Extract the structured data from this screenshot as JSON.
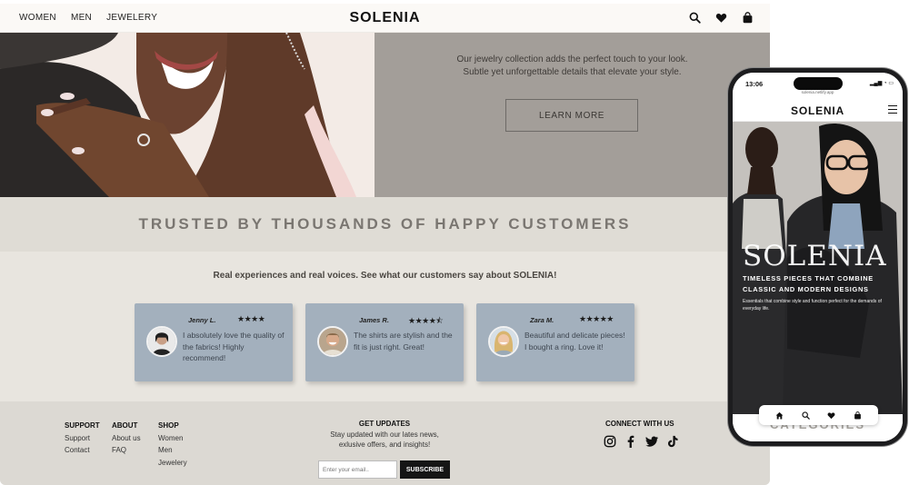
{
  "desktop": {
    "nav": {
      "links": [
        "WOMEN",
        "MEN",
        "JEWELERY"
      ],
      "brand": "SOLENIA",
      "icons": [
        "search-icon",
        "heart-icon",
        "bag-icon"
      ]
    },
    "hero": {
      "text_line1": "Our jewelry collection adds the perfect touch to your look.",
      "text_line2": "Subtle yet unforgettable details that elevate your style.",
      "cta": "LEARN MORE"
    },
    "trusted_heading": "TRUSTED BY THOUSANDS OF HAPPY CUSTOMERS",
    "reviews_subtitle": "Real experiences and real voices. See what our customers say about SOLENIA!",
    "reviews": [
      {
        "name": "Jenny L.",
        "stars": "★★★★",
        "text": "I absolutely love the quality of the fabrics! Highly recommend!"
      },
      {
        "name": "James R.",
        "stars": "★★★★⯪",
        "text": "The shirts are stylish and the fit is just right. Great!"
      },
      {
        "name": "Zara M.",
        "stars": "★★★★★",
        "text": "Beautiful and delicate pieces! I bought a ring. Love it!"
      }
    ],
    "footer": {
      "support": {
        "heading": "SUPPORT",
        "items": [
          "Support",
          "Contact"
        ]
      },
      "about": {
        "heading": "ABOUT",
        "items": [
          "About us",
          "FAQ"
        ]
      },
      "shop": {
        "heading": "SHOP",
        "items": [
          "Women",
          "Men",
          "Jewelery"
        ]
      },
      "updates": {
        "heading": "GET UPDATES",
        "line1": "Stay updated with our lates news,",
        "line2": "exlusive offers, and insights!",
        "placeholder": "Enter your email..",
        "button": "SUBSCRIBE"
      },
      "connect": {
        "heading": "CONNECT WITH US",
        "icons": [
          "instagram-icon",
          "facebook-icon",
          "twitter-icon",
          "tiktok-icon"
        ]
      }
    }
  },
  "phone": {
    "time": "13:06",
    "url": "solenia.netlify.app",
    "brand": "SOLENIA",
    "hero_title": "SOLENIA",
    "tagline_line1": "TIMELESS PIECES THAT COMBINE",
    "tagline_line2": "CLASSIC AND MODERN DESIGNS",
    "description": "Essentials that combine style and function perfect for the demands of everyday life.",
    "categories_heading": "CATEGORIES",
    "bottom_icons": [
      "home-icon",
      "search-icon",
      "heart-icon",
      "bag-icon"
    ]
  }
}
